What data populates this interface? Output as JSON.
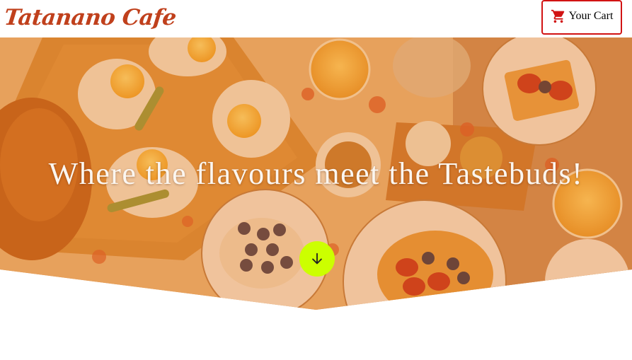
{
  "header": {
    "brand": "Tatanano Cafe",
    "cart_label": "Your Cart",
    "cart_icon": "shopping-cart-icon"
  },
  "hero": {
    "tagline": "Where the flavours meet the Tastebuds!",
    "scroll_icon": "arrow-down-icon"
  },
  "colors": {
    "brand": "#c0401c",
    "cart_border": "#d11313",
    "scroll_button": "#ccff00",
    "hero_tint": "#e4781e"
  }
}
